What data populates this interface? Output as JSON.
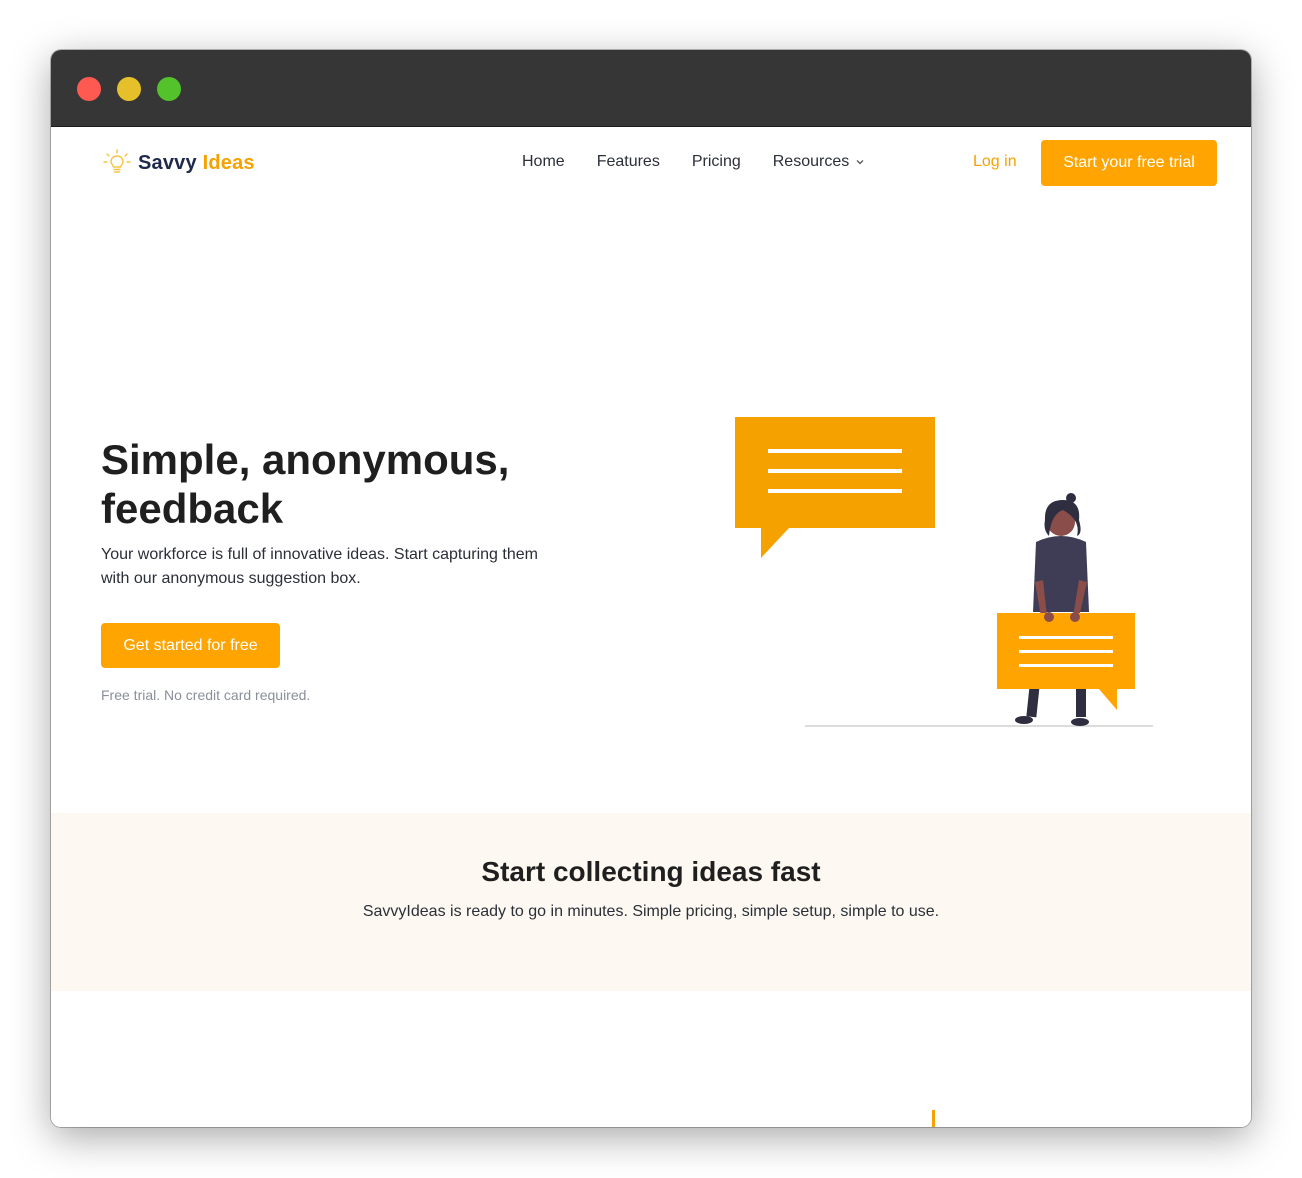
{
  "window": {
    "controls": [
      "close",
      "minimize",
      "zoom"
    ]
  },
  "header": {
    "logo": {
      "part1": "Savvy",
      "part2": "Ideas",
      "icon": "lightbulb-icon"
    },
    "nav": [
      {
        "label": "Home"
      },
      {
        "label": "Features"
      },
      {
        "label": "Pricing"
      },
      {
        "label": "Resources",
        "icon": "chevron-down-icon"
      }
    ],
    "login_label": "Log in",
    "trial_label": "Start your free trial"
  },
  "hero": {
    "title": "Simple, anonymous, feedback",
    "subtitle": "Your workforce is full of innovative ideas. Start capturing them with our anonymous suggestion box.",
    "cta_label": "Get started for free",
    "note": "Free trial. No credit card required."
  },
  "band": {
    "title": "Start collecting ideas fast",
    "subtitle": "SavvyIdeas is ready to go in minutes. Simple pricing, simple setup, simple to use."
  },
  "colors": {
    "accent": "#ffa400",
    "brand_dark": "#1e2a4a",
    "titlebar": "#363636",
    "band_bg": "#fdf9f2"
  }
}
